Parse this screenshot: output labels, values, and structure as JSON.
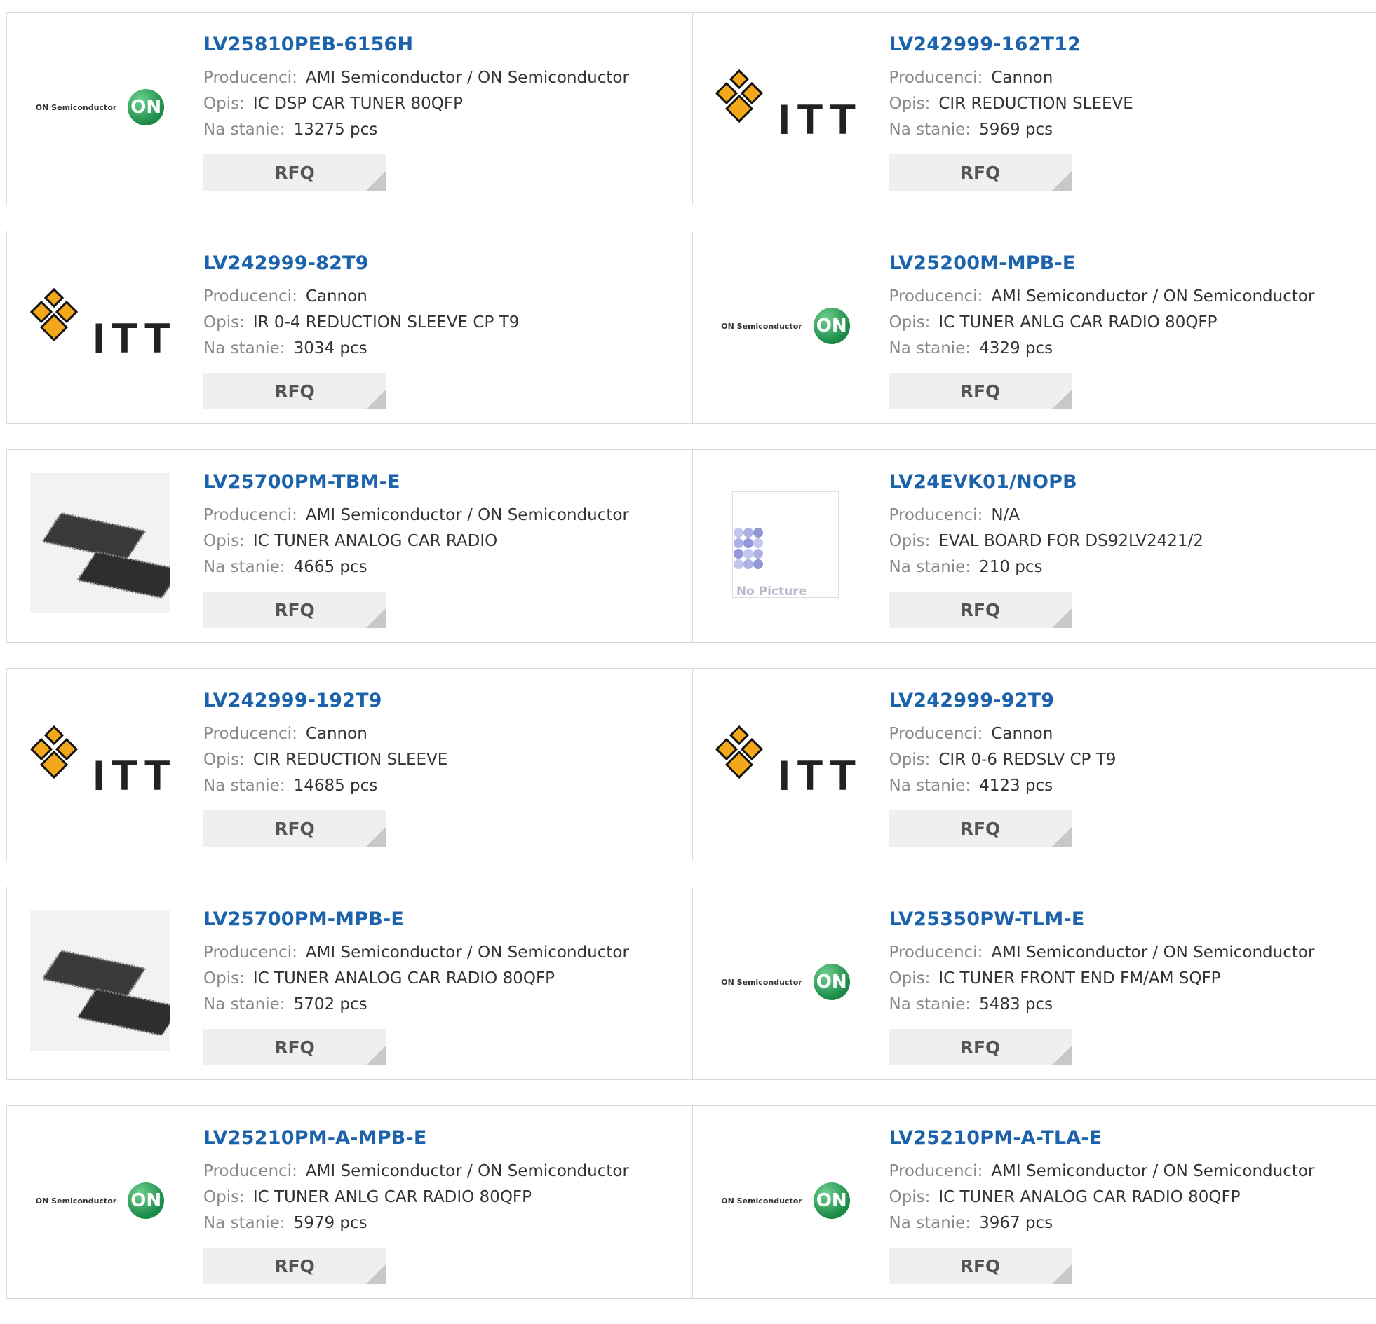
{
  "rfq_label": "RFQ",
  "labels": {
    "manufacturer": "Producenci:",
    "description": "Opis:",
    "stock": "Na stanie:"
  },
  "logo_text": {
    "on_semi": "ON Semiconductor",
    "on_badge": "ON",
    "itt": "ITT",
    "no_picture": "No Picture"
  },
  "products": [
    {
      "part": "LV25810PEB-6156H",
      "manufacturer": "AMI Semiconductor / ON Semiconductor",
      "description": "IC DSP CAR TUNER 80QFP",
      "stock": "13275 pcs",
      "image": "on-semi-logo"
    },
    {
      "part": "LV242999-162T12",
      "manufacturer": "Cannon",
      "description": "CIR REDUCTION SLEEVE",
      "stock": "5969 pcs",
      "image": "itt-logo"
    },
    {
      "part": "LV242999-82T9",
      "manufacturer": "Cannon",
      "description": "IR 0-4 REDUCTION SLEEVE CP T9",
      "stock": "3034 pcs",
      "image": "itt-logo"
    },
    {
      "part": "LV25200M-MPB-E",
      "manufacturer": "AMI Semiconductor / ON Semiconductor",
      "description": "IC TUNER ANLG CAR RADIO 80QFP",
      "stock": "4329 pcs",
      "image": "on-semi-logo"
    },
    {
      "part": "LV25700PM-TBM-E",
      "manufacturer": "AMI Semiconductor / ON Semiconductor",
      "description": "IC TUNER ANALOG CAR RADIO",
      "stock": "4665 pcs",
      "image": "chip-photo"
    },
    {
      "part": "LV24EVK01/NOPB",
      "manufacturer": "N/A",
      "description": "EVAL BOARD FOR DS92LV2421/2",
      "stock": "210 pcs",
      "image": "no-picture"
    },
    {
      "part": "LV242999-192T9",
      "manufacturer": "Cannon",
      "description": "CIR REDUCTION SLEEVE",
      "stock": "14685 pcs",
      "image": "itt-logo"
    },
    {
      "part": "LV242999-92T9",
      "manufacturer": "Cannon",
      "description": "CIR 0-6 REDSLV CP T9",
      "stock": "4123 pcs",
      "image": "itt-logo"
    },
    {
      "part": "LV25700PM-MPB-E",
      "manufacturer": "AMI Semiconductor / ON Semiconductor",
      "description": "IC TUNER ANALOG CAR RADIO 80QFP",
      "stock": "5702 pcs",
      "image": "chip-photo"
    },
    {
      "part": "LV25350PW-TLM-E",
      "manufacturer": "AMI Semiconductor / ON Semiconductor",
      "description": "IC TUNER FRONT END FM/AM SQFP",
      "stock": "5483 pcs",
      "image": "on-semi-logo"
    },
    {
      "part": "LV25210PM-A-MPB-E",
      "manufacturer": "AMI Semiconductor / ON Semiconductor",
      "description": "IC TUNER ANLG CAR RADIO 80QFP",
      "stock": "5979 pcs",
      "image": "on-semi-logo"
    },
    {
      "part": "LV25210PM-A-TLA-E",
      "manufacturer": "AMI Semiconductor / ON Semiconductor",
      "description": "IC TUNER ANALOG CAR RADIO 80QFP",
      "stock": "3967 pcs",
      "image": "on-semi-logo"
    }
  ],
  "colors": {
    "link": "#1d63ac",
    "label": "#8a8a8a",
    "value": "#333333",
    "button_bg": "#efefef",
    "border": "#d9d9d9"
  }
}
